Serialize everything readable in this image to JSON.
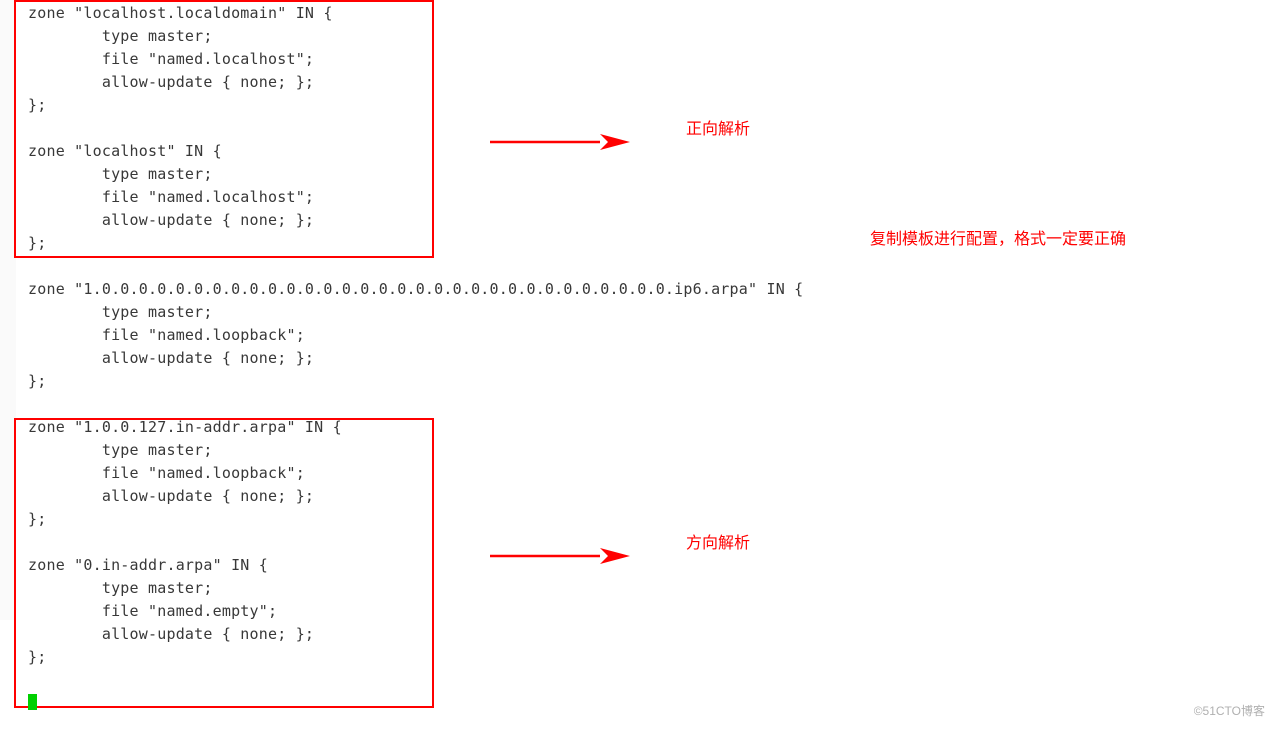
{
  "code": {
    "lines": [
      "zone \"localhost.localdomain\" IN {",
      "        type master;",
      "        file \"named.localhost\";",
      "        allow-update { none; };",
      "};",
      "",
      "zone \"localhost\" IN {",
      "        type master;",
      "        file \"named.localhost\";",
      "        allow-update { none; };",
      "};",
      "",
      "zone \"1.0.0.0.0.0.0.0.0.0.0.0.0.0.0.0.0.0.0.0.0.0.0.0.0.0.0.0.0.0.0.0.ip6.arpa\" IN {",
      "        type master;",
      "        file \"named.loopback\";",
      "        allow-update { none; };",
      "};",
      "",
      "zone \"1.0.0.127.in-addr.arpa\" IN {",
      "        type master;",
      "        file \"named.loopback\";",
      "        allow-update { none; };",
      "};",
      "",
      "zone \"0.in-addr.arpa\" IN {",
      "        type master;",
      "        file \"named.empty\";",
      "        allow-update { none; };",
      "};"
    ]
  },
  "annotations": {
    "forward": "正向解析",
    "copy_template": "复制模板进行配置，格式一定要正确",
    "reverse": "方向解析"
  },
  "watermark": "©51CTO博客"
}
